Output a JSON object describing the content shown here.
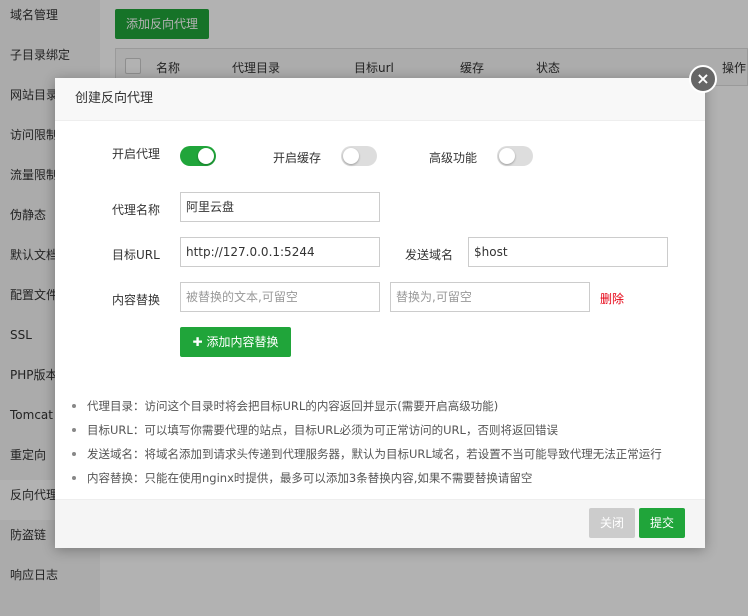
{
  "sidebar": {
    "items": [
      {
        "label": "域名管理"
      },
      {
        "label": "子目录绑定"
      },
      {
        "label": "网站目录"
      },
      {
        "label": "访问限制"
      },
      {
        "label": "流量限制"
      },
      {
        "label": "伪静态"
      },
      {
        "label": "默认文档"
      },
      {
        "label": "配置文件"
      },
      {
        "label": "SSL"
      },
      {
        "label": "PHP版本"
      },
      {
        "label": "Tomcat"
      },
      {
        "label": "重定向"
      },
      {
        "label": "反向代理"
      },
      {
        "label": "防盗链"
      },
      {
        "label": "响应日志"
      }
    ]
  },
  "main": {
    "add_proxy_label": "添加反向代理",
    "table_headers": [
      "名称",
      "代理目录",
      "目标url",
      "缓存",
      "状态",
      "操作"
    ]
  },
  "modal": {
    "title": "创建反向代理",
    "close_icon": "×",
    "toggles": {
      "proxy_label": "开启代理",
      "proxy_on": true,
      "cache_label": "开启缓存",
      "cache_on": false,
      "advanced_label": "高级功能",
      "advanced_on": false
    },
    "fields": {
      "name_label": "代理名称",
      "name_value": "阿里云盘",
      "target_url_label": "目标URL",
      "target_url_value": "http://127.0.0.1:5244",
      "send_domain_label": "发送域名",
      "send_domain_value": "$host",
      "replace_label": "内容替换",
      "replace_from_placeholder": "被替换的文本,可留空",
      "replace_to_placeholder": "替换为,可留空",
      "delete_label": "删除"
    },
    "add_replace_label": "添加内容替换",
    "plus_icon": "✚",
    "tips": [
      "代理目录：访问这个目录时将会把目标URL的内容返回并显示(需要开启高级功能)",
      "目标URL：可以填写你需要代理的站点，目标URL必须为可正常访问的URL，否则将返回错误",
      "发送域名：将域名添加到请求头传递到代理服务器，默认为目标URL域名，若设置不当可能导致代理无法正常运行",
      "内容替换：只能在使用nginx时提供，最多可以添加3条替换内容,如果不需要替换请留空"
    ],
    "footer": {
      "close_label": "关闭",
      "submit_label": "提交"
    }
  },
  "colors": {
    "accent": "#20a53a",
    "danger": "#e60012"
  }
}
